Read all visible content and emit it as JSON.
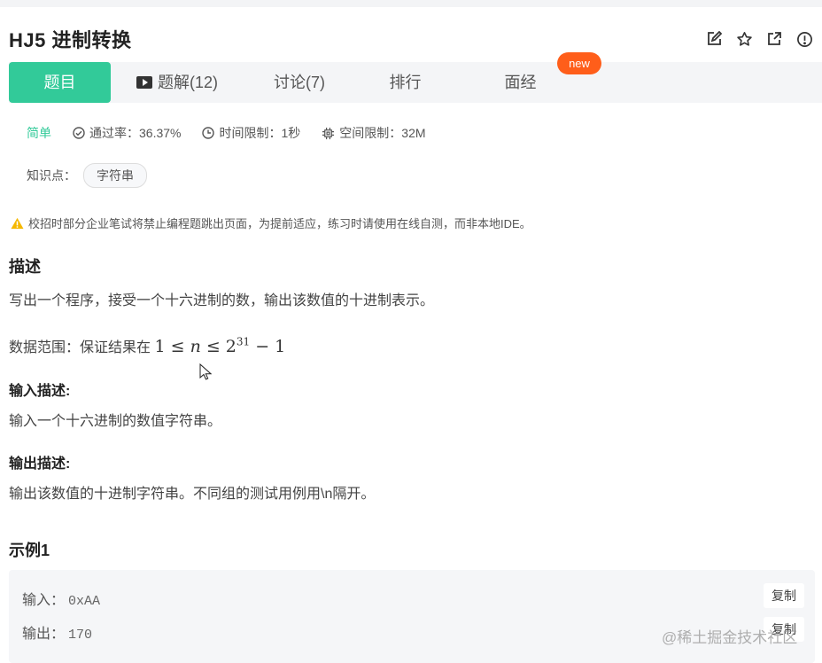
{
  "header": {
    "title": "HJ5  进制转换",
    "icons": [
      "edit-icon",
      "star-icon",
      "external-link-icon",
      "info-icon"
    ]
  },
  "tabs": [
    {
      "label": "题目",
      "active": true
    },
    {
      "label": "题解(12)",
      "icon": "play-icon"
    },
    {
      "label": "讨论(7)"
    },
    {
      "label": "排行"
    },
    {
      "label": "面经"
    }
  ],
  "new_badge": "new",
  "meta": {
    "difficulty": "简单",
    "pass_rate": "通过率：36.37%",
    "time_limit": "时间限制：1秒",
    "space_limit": "空间限制：32M"
  },
  "knowledge": {
    "label": "知识点：",
    "tag": "字符串"
  },
  "warning": "校招时部分企业笔试将禁止编程题跳出页面，为提前适应，练习时请使用在线自测，而非本地IDE。",
  "description": {
    "heading": "描述",
    "text": "写出一个程序，接受一个十六进制的数，输出该数值的十进制表示。",
    "range_prefix": "数据范围：保证结果在",
    "range_math": {
      "left": "1 ≤ ",
      "var": "n",
      "mid": " ≤ 2",
      "exp": "31",
      "right": " − 1"
    }
  },
  "input_desc": {
    "heading": "输入描述:",
    "text": "输入一个十六进制的数值字符串。"
  },
  "output_desc": {
    "heading": "输出描述:",
    "text": "输出该数值的十进制字符串。不同组的测试用例用\\n隔开。"
  },
  "example": {
    "heading": "示例1",
    "input_label": "输入：",
    "input_value": "0xAA",
    "output_label": "输出：",
    "output_value": "170",
    "copy_label": "复制"
  },
  "watermark": "@稀土掘金技术社区",
  "colors": {
    "accent": "#32ca99",
    "badge": "#ff5e1a",
    "warning": "#f5b800"
  }
}
